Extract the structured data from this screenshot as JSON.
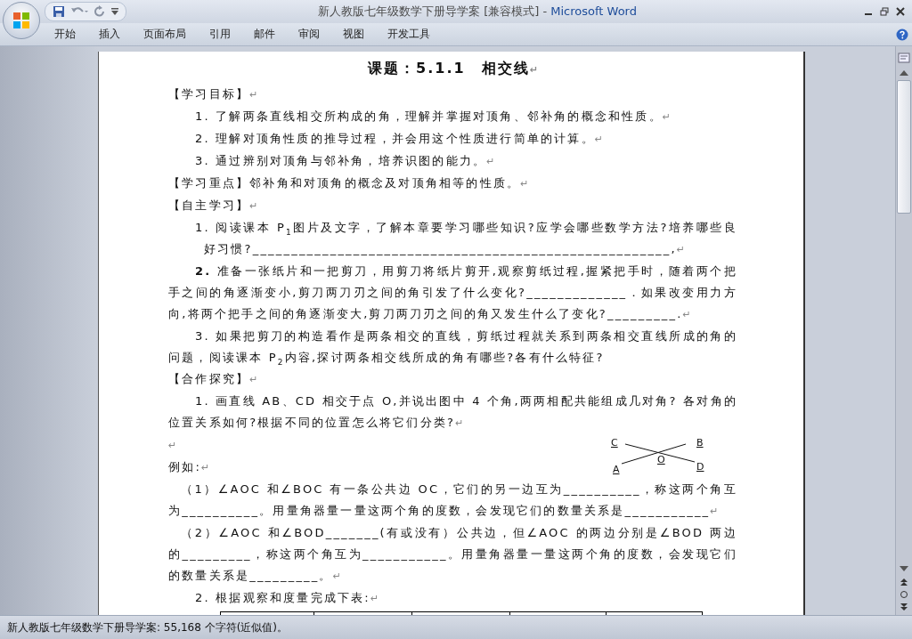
{
  "window": {
    "title": "新人教版七年级数学下册导学案 [兼容模式]",
    "separator": " - ",
    "app": "Microsoft Word"
  },
  "ribbon_tabs": [
    "开始",
    "插入",
    "页面布局",
    "引用",
    "邮件",
    "审阅",
    "视图",
    "开发工具"
  ],
  "document": {
    "title": "课题：5.1.1　相交线",
    "title_mark": "↵",
    "blocks": [
      {
        "kind": "heading",
        "text": "【学习目标】",
        "mark": "↵"
      },
      {
        "kind": "item",
        "text": "1. 了解两条直线相交所构成的角，理解并掌握对顶角、邻补角的概念和性质。",
        "mark": "↵"
      },
      {
        "kind": "item",
        "text": "2. 理解对顶角性质的推导过程，并会用这个性质进行简单的计算。",
        "mark": "↵"
      },
      {
        "kind": "item",
        "text": "3. 通过辨别对顶角与邻补角，培养识图的能力。",
        "mark": "↵"
      },
      {
        "kind": "heading",
        "text": "【学习重点】邻补角和对顶角的概念及对顶角相等的性质。",
        "mark": "↵"
      },
      {
        "kind": "heading",
        "text": "【自主学习】",
        "mark": "↵"
      },
      {
        "kind": "item",
        "text": "1. 阅读课本 P$_{1}$图片及文字，了解本章要学习哪些知识?应学会哪些数学方法?培养哪些良好习惯?______________________________________________________,",
        "mark": "↵"
      },
      {
        "kind": "para",
        "text": "**2.** 准备一张纸片和一把剪刀，用剪刀将纸片剪开,观察剪纸过程,握紧把手时，随着两个把手之间的角逐渐变小,剪刀两刀刃之间的角引发了什么变化?_____________．如果改变用力方向,将两个把手之间的角逐渐变大,剪刀两刀刃之间的角又发生什么了变化?_________.",
        "mark": "↵"
      },
      {
        "kind": "para",
        "text": "3. 如果把剪刀的构造看作是两条相交的直线，剪纸过程就关系到两条相交直线所成的角的问题，阅读课本 P$_{2}$内容,探讨两条相交线所成的角有哪些?各有什么特征?"
      },
      {
        "kind": "heading",
        "text": "【合作探究】",
        "mark": "↵"
      },
      {
        "kind": "para",
        "text": "1. 画直线 AB、CD 相交于点 O,并说出图中 4 个角,两两相配共能组成几对角? 各对角的位置关系如何?根据不同的位置怎么将它们分类?",
        "mark": "↵"
      },
      {
        "kind": "blank",
        "mark": "↵"
      },
      {
        "kind": "heading",
        "text": "例如:",
        "mark": "↵"
      },
      {
        "kind": "example",
        "text": "（1）∠AOC 和∠BOC 有一条公共边 OC，它们的另一边互为__________，称这两个角互为__________。用量角器量一量这两个角的度数，会发现它们的数量关系是___________",
        "mark": "↵"
      },
      {
        "kind": "example",
        "text": "（2）∠AOC 和∠BOD_______(有或没有）公共边，但∠AOC 的两边分别是∠BOD 两边的_________，称这两个角互为___________。用量角器量一量这两个角的度数，会发现它们的数量关系是_________。",
        "mark": "↵"
      },
      {
        "kind": "item",
        "text": "2. 根据观察和度量完成下表:",
        "mark": "↵"
      }
    ],
    "figure_labels": [
      "C",
      "B",
      "O",
      "A",
      "D"
    ]
  },
  "status_bar": {
    "text": "新人教版七年级数学下册导学案: 55,168 个字符(近似值)。"
  }
}
